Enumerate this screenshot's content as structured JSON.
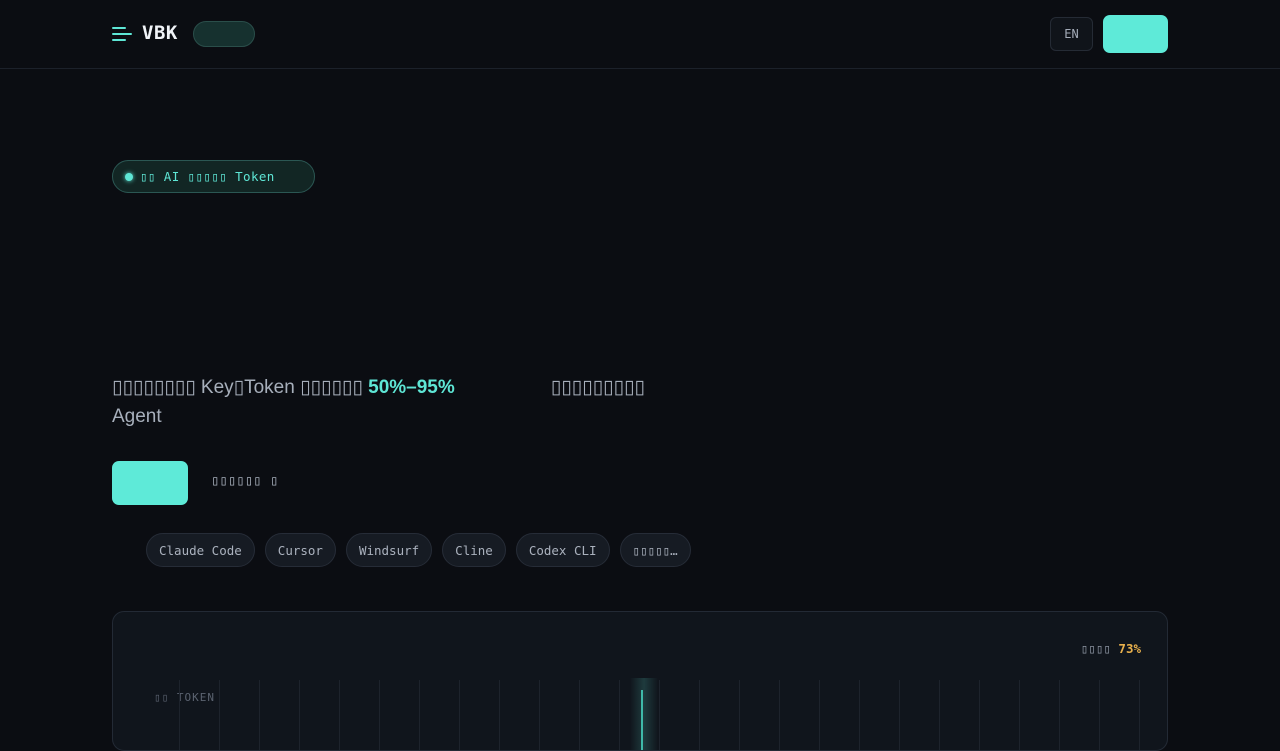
{
  "header": {
    "logo": "VBK",
    "lang_label": "EN",
    "cta_label": ""
  },
  "hero": {
    "badge_text": "▯▯ AI ▯▯▯▯▯ Token",
    "desc_part1": "▯▯▯▯▯▯▯▯ Key▯Token ▯▯▯▯▯▯ ",
    "desc_accent": "50%–95%",
    "desc_part2": "▯▯▯▯▯▯▯▯▯",
    "desc_line2": "Agent",
    "primary_label": "",
    "secondary_label": "▯▯▯▯▯▯ ▯"
  },
  "tools": [
    "Claude Code",
    "Cursor",
    "Windsurf",
    "Cline",
    "Codex CLI",
    "▯▯▯▯▯…"
  ],
  "panel": {
    "stat_label": "▯▯▯▯ ",
    "stat_value": "73%",
    "axis_label": "▯▯ TOKEN"
  },
  "colors": {
    "accent": "#5eead8",
    "background": "#0b0d12",
    "warning": "#e8b04c"
  },
  "icons": {
    "menu": "hamburger-menu-icon",
    "badge_dot": "status-dot-icon"
  }
}
